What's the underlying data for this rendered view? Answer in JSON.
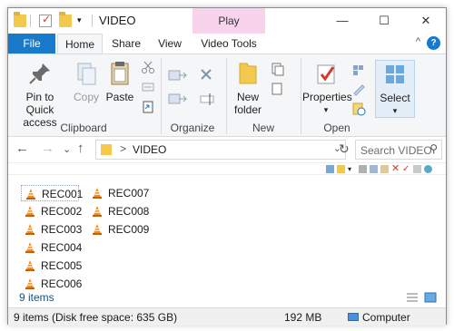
{
  "window": {
    "title": "VIDEO",
    "context_tab": "Play"
  },
  "title_controls": {
    "minimize": "—",
    "maximize": "☐",
    "close": "✕"
  },
  "tabs": {
    "file": "File",
    "home": "Home",
    "share": "Share",
    "view": "View",
    "video_tools": "Video Tools",
    "collapse": "^",
    "help": "?"
  },
  "ribbon": {
    "clipboard": {
      "pin": "Pin to Quick access",
      "copy": "Copy",
      "paste": "Paste",
      "label": "Clipboard"
    },
    "organize": {
      "label": "Organize"
    },
    "new": {
      "new_folder": "New folder",
      "label": "New"
    },
    "open": {
      "properties": "Properties",
      "label": "Open"
    },
    "select": {
      "select": "Select"
    }
  },
  "navigation": {
    "back": "←",
    "forward": "→",
    "dropdown": "⌄",
    "up": "↑",
    "path_sep": ">",
    "path": "VIDEO",
    "search_placeholder": "Search VIDEO"
  },
  "files": {
    "col1": [
      "REC001",
      "REC002",
      "REC003",
      "REC004",
      "REC005",
      "REC006"
    ],
    "col2": [
      "REC007",
      "REC008",
      "REC009"
    ]
  },
  "content_status": {
    "items": "9 items"
  },
  "statusbar": {
    "summary": "9 items (Disk free space: 635 GB)",
    "size": "192 MB",
    "location": "Computer"
  },
  "colors": {
    "accent": "#1979ca",
    "context": "#f7d4ec",
    "folder": "#f2c94c",
    "vlc": "#f48a20"
  }
}
